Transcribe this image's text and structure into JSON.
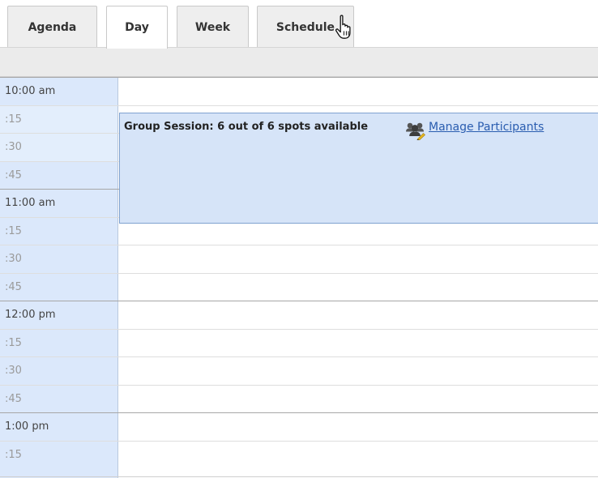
{
  "tabs": {
    "agenda": "Agenda",
    "day": "Day",
    "week": "Week",
    "schedule": "Schedule",
    "active": "Day"
  },
  "timeslots": [
    {
      "label": "10:00 am",
      "kind": "hour"
    },
    {
      "label": ":15",
      "kind": "quarter"
    },
    {
      "label": ":30",
      "kind": "quarter"
    },
    {
      "label": ":45",
      "kind": "quarter"
    },
    {
      "label": "11:00 am",
      "kind": "hour"
    },
    {
      "label": ":15",
      "kind": "quarter"
    },
    {
      "label": ":30",
      "kind": "quarter"
    },
    {
      "label": ":45",
      "kind": "quarter"
    },
    {
      "label": "12:00 pm",
      "kind": "hour"
    },
    {
      "label": ":15",
      "kind": "quarter"
    },
    {
      "label": ":30",
      "kind": "quarter"
    },
    {
      "label": ":45",
      "kind": "quarter"
    },
    {
      "label": "1:00 pm",
      "kind": "hour"
    },
    {
      "label": ":15",
      "kind": "quarter"
    }
  ],
  "event": {
    "title": "Group Session: 6 out of 6 spots available",
    "action_label": "Manage Participants",
    "icon": "group-users-icon"
  },
  "colors": {
    "time_column": "#dbe8fb",
    "event_fill": "#d6e4f8",
    "event_border": "#7fa2d0",
    "link": "#2a5db0"
  }
}
